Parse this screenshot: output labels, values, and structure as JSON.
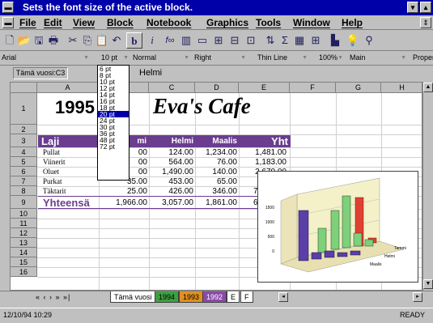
{
  "titlebar": {
    "text": "Sets the font size of the active block."
  },
  "menu": {
    "items": [
      "File",
      "Edit",
      "View",
      "Block",
      "Notebook",
      "Graphics",
      "Tools",
      "Window",
      "Help"
    ]
  },
  "propbar": {
    "font": "Arial",
    "size": "10 pt",
    "style": "Normal",
    "align": "Right",
    "line": "Thin Line",
    "zoom": "100%",
    "page": "Main",
    "extra": "Proper"
  },
  "inputline": {
    "cellref": "Tämä vuosi:C3",
    "value": "Helmi"
  },
  "sheet": {
    "columns": [
      "A",
      "B",
      "C",
      "D",
      "E",
      "F",
      "G",
      "H"
    ],
    "rows": [
      "1",
      "2",
      "3",
      "4",
      "5",
      "6",
      "7",
      "8",
      "9",
      "10",
      "11",
      "12",
      "13",
      "14",
      "15",
      "16"
    ],
    "title_year": "1995",
    "title_name": "Eva's Cafe",
    "header": {
      "label": "Laji",
      "b": "mi",
      "c": "Helmi",
      "d": "Maalis",
      "e": "Yht"
    },
    "data": [
      {
        "label": "Pullat",
        "b": "00",
        "c": "124.00",
        "d": "1,234.00",
        "e": "1,481.00"
      },
      {
        "label": "Viinerit",
        "b": "00",
        "c": "564.00",
        "d": "76.00",
        "e": "1,183.00"
      },
      {
        "label": "Oluet",
        "b": "00",
        "c": "1,490.00",
        "d": "140.00",
        "e": "2,670.00"
      },
      {
        "label": "Purkat",
        "b": "35.00",
        "c": "453.00",
        "d": "65.00",
        "e": "5"
      },
      {
        "label": "Täktarit",
        "b": "25.00",
        "c": "426.00",
        "d": "346.00",
        "e": "7"
      }
    ],
    "total": {
      "label": "Yhteensä",
      "b": "1,966.00",
      "c": "3,057.00",
      "d": "1,861.00",
      "e": "6,8"
    }
  },
  "fontsizes": [
    "6 pt",
    "8 pt",
    "10 pt",
    "12 pt",
    "14 pt",
    "16 pt",
    "18 pt",
    "20 pt",
    "24 pt",
    "30 pt",
    "36 pt",
    "48 pt",
    "72 pt"
  ],
  "fontsize_selected": "20 pt",
  "tabs": {
    "nav": "« ‹ › » »|",
    "t1": "Tämä vuosi",
    "t2": "1994",
    "t3": "1993",
    "t4": "1992",
    "t5": "E",
    "t6": "F"
  },
  "status": {
    "datetime": "12/10/94 10:29",
    "mode": "READY"
  },
  "chart_data": {
    "type": "bar",
    "title": "",
    "yticks": [
      "1500",
      "1000",
      "500",
      "0"
    ],
    "ylim": [
      0,
      1500
    ],
    "series_labels": [
      "Tammi",
      "Helmi",
      "Maalis"
    ],
    "colors": {
      "purple": "#5a3fa8",
      "green": "#7ed07a",
      "red": "#e04030"
    }
  }
}
